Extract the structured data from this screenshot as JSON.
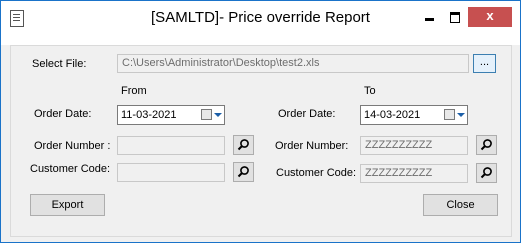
{
  "window": {
    "title": "[SAMLTD]- Price override Report",
    "close_glyph": "x"
  },
  "form": {
    "select_file_label": "Select File:",
    "file_path": "C:\\Users\\Administrator\\Desktop\\test2.xls",
    "browse_label": "...",
    "from_label": "From",
    "to_label": "To",
    "order_date_label": "Order Date:",
    "from_order_date": "11-03-2021",
    "to_order_date": "14-03-2021",
    "from_order_number_label": "Order Number :",
    "to_order_number_label": "Order Number:",
    "from_order_number": "",
    "to_order_number": "ZZZZZZZZZZ",
    "customer_code_label": "Customer Code:",
    "from_customer_code": "",
    "to_customer_code": "ZZZZZZZZZZ"
  },
  "buttons": {
    "export": "Export",
    "close": "Close"
  }
}
